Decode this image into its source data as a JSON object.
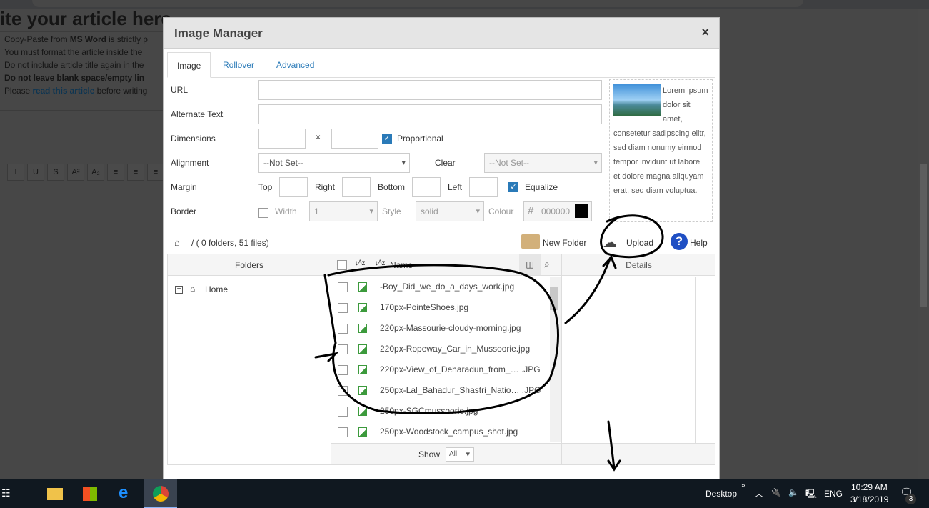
{
  "page": {
    "heading": "ite your article here.",
    "notes": [
      {
        "pre": "Copy-Paste from ",
        "bold": "MS Word",
        "post": " is strictly p"
      },
      {
        "text": "You must format the article inside the"
      },
      {
        "text": "Do not include article title again in the"
      },
      {
        "bold": "Do not leave blank space/empty lin"
      },
      {
        "pre": "Please ",
        "link": "read this article",
        "post": " before writing"
      }
    ],
    "toolbar": [
      "I",
      "U",
      "S",
      "A²",
      "A₂",
      "≡",
      "≡",
      "≡"
    ]
  },
  "dialog": {
    "title": "Image Manager",
    "close": "×",
    "tabs": [
      "Image",
      "Rollover",
      "Advanced"
    ],
    "fields": {
      "url": "URL",
      "alt": "Alternate Text",
      "dimensions": "Dimensions",
      "times": "×",
      "proportional": "Proportional",
      "alignment": "Alignment",
      "alignment_value": "--Not Set--",
      "clear": "Clear",
      "clear_value": "--Not Set--",
      "margin": "Margin",
      "top": "Top",
      "right": "Right",
      "bottom": "Bottom",
      "left": "Left",
      "equalize": "Equalize",
      "border": "Border",
      "width": "Width",
      "width_value": "1",
      "style": "Style",
      "style_value": "solid",
      "colour": "Colour",
      "colour_value": "000000",
      "colour_hex": "#000000"
    },
    "preview_text": "Lorem ipsum dolor sit amet, consetetur sadipscing elitr, sed diam nonumy eirmod tempor invidunt ut labore et dolore magna aliquyam erat, sed diam voluptua.",
    "path": "/  ( 0 folders, 51 files)",
    "new_folder": "New Folder",
    "upload": "Upload",
    "help": "Help",
    "folders_header": "Folders",
    "home": "Home",
    "name_header": "Name",
    "details_header": "Details",
    "files": [
      "-Boy_Did_we_do_a_days_work.jpg",
      "170px-PointeShoes.jpg",
      "220px-Massourie-cloudy-morning.jpg",
      "220px-Ropeway_Car_in_Mussoorie.jpg",
      "220px-View_of_Deharadun_from_…  .JPG",
      "250px-Lal_Bahadur_Shastri_Natio…  .JPG",
      "250px-SGCmussoorie.jpg",
      "250px-Woodstock_campus_shot.jpg"
    ],
    "show": "Show",
    "show_value": "All"
  },
  "taskbar": {
    "desktop": "Desktop",
    "lang": "ENG",
    "time": "10:29 AM",
    "date": "3/18/2019",
    "notifications": "3"
  }
}
